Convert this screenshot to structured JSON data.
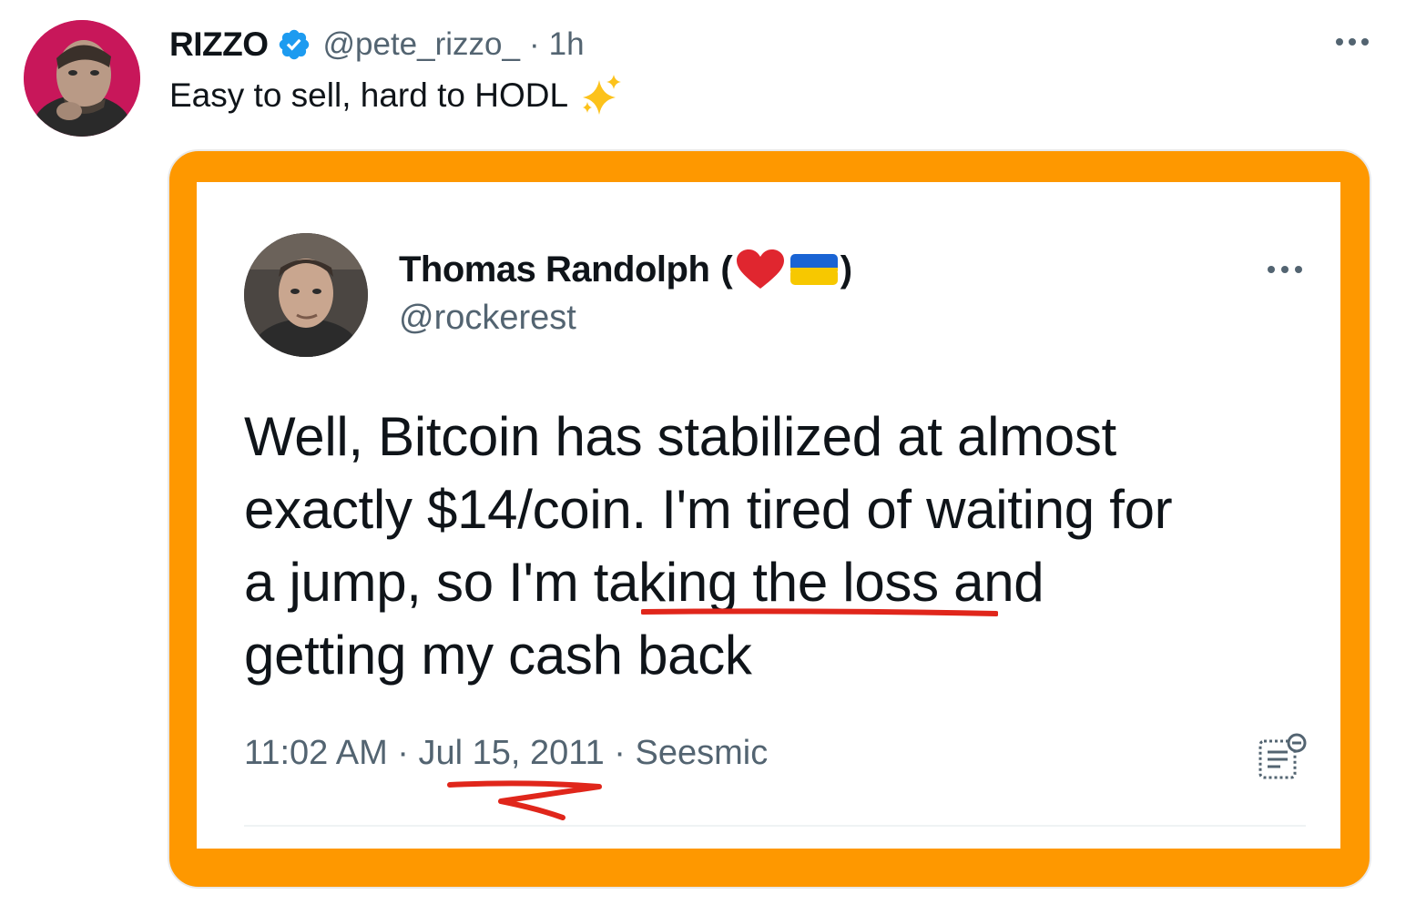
{
  "tweet": {
    "author_name": "RIZZO",
    "handle": "@pete_rizzo_",
    "separator": "·",
    "time": "1h",
    "text": "Easy to sell, hard to HODL",
    "emoji": "sparkles-emoji"
  },
  "quoted": {
    "name": "Thomas Randolph",
    "paren_open": "(",
    "paren_close": ")",
    "handle": "@rockerest",
    "lines": [
      "Well, Bitcoin has stabilized at almost",
      "exactly $14/coin.  I'm tired of waiting for",
      "a jump, so I'm taking the loss and",
      "getting my cash back"
    ],
    "time": "11:02 AM",
    "sep1": " · ",
    "date": "Jul 15, 2011",
    "sep2": " · ",
    "source": "Seesmic"
  },
  "colors": {
    "accent_blue": "#1d9bf0",
    "frame_orange": "#fe9800",
    "annotation_red": "#e0261b"
  },
  "icons": [
    "verified-badge-icon",
    "more-icon",
    "heart-icon",
    "ukraine-flag-icon",
    "notes-icon"
  ]
}
